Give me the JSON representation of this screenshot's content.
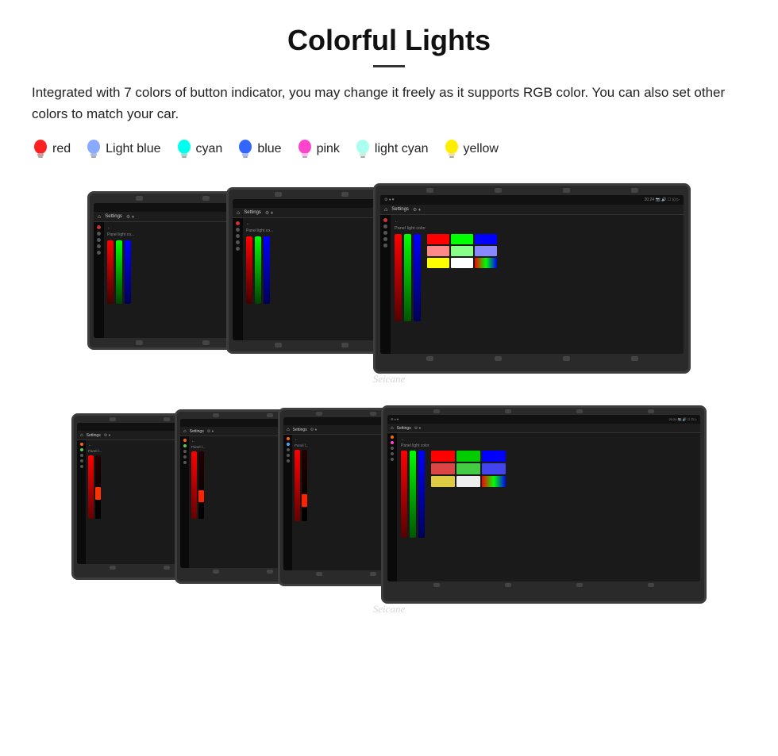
{
  "page": {
    "title": "Colorful Lights",
    "divider": true,
    "description": "Integrated with 7 colors of button indicator, you may change it freely as it supports RGB color. You can also set other colors to match your car.",
    "colors": [
      {
        "name": "red",
        "color": "#ff2020",
        "type": "red"
      },
      {
        "name": "Light blue",
        "color": "#88aaff",
        "type": "lightblue"
      },
      {
        "name": "cyan",
        "color": "#00ffee",
        "type": "cyan"
      },
      {
        "name": "blue",
        "color": "#3366ff",
        "type": "blue"
      },
      {
        "name": "pink",
        "color": "#ff44cc",
        "type": "pink"
      },
      {
        "name": "light cyan",
        "color": "#aaffee",
        "type": "lightcyan"
      },
      {
        "name": "yellow",
        "color": "#ffee00",
        "type": "yellow"
      }
    ],
    "watermark": "Seicane",
    "settings_label": "Settings",
    "panel_light_label": "Panel light color",
    "back_arrow": "←"
  }
}
